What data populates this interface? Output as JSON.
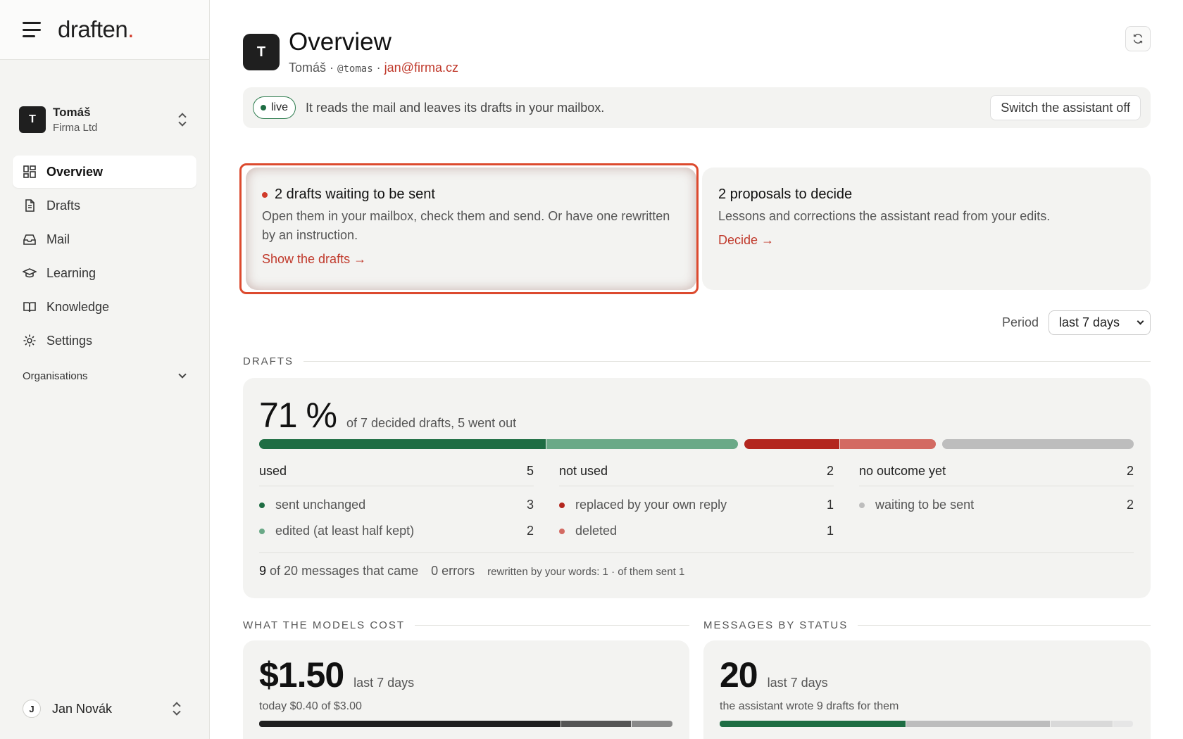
{
  "brand": {
    "name": "draften",
    "dot": "."
  },
  "account": {
    "initial": "T",
    "name": "Tomáš",
    "org": "Firma Ltd"
  },
  "nav": [
    {
      "label": "Overview",
      "icon": "dashboard-icon",
      "active": true
    },
    {
      "label": "Drafts",
      "icon": "document-icon"
    },
    {
      "label": "Mail",
      "icon": "inbox-icon"
    },
    {
      "label": "Learning",
      "icon": "graduation-cap-icon"
    },
    {
      "label": "Knowledge",
      "icon": "book-icon"
    },
    {
      "label": "Settings",
      "icon": "gear-icon"
    }
  ],
  "organisations_label": "Organisations",
  "user": {
    "initial": "J",
    "name": "Jan Novák"
  },
  "header": {
    "initial": "T",
    "title": "Overview",
    "name": "Tomáš",
    "handle": "@tomas",
    "email": "jan@firma.cz",
    "sep": "·"
  },
  "status": {
    "badge": "live",
    "text": "It reads the mail and leaves its drafts in your mailbox.",
    "button": "Switch the assistant off"
  },
  "cards": {
    "drafts_waiting": {
      "title": "2 drafts waiting to be sent",
      "desc": "Open them in your mailbox, check them and send. Or have one rewritten by an instruction.",
      "link": "Show the drafts →"
    },
    "proposals": {
      "title": "2 proposals to decide",
      "desc": "Lessons and corrections the assistant read from your edits.",
      "link": "Decide →"
    }
  },
  "period": {
    "label": "Period",
    "value": "last 7 days"
  },
  "drafts": {
    "section": "DRAFTS",
    "percent": "71 %",
    "summary": "of 7 decided drafts, 5 went out",
    "bar": [
      {
        "name": "sent-unchanged",
        "value": 3,
        "color": "#1e6d43"
      },
      {
        "name": "edited",
        "value": 2,
        "color": "#6aa987"
      },
      {
        "name": "replaced",
        "value": 1,
        "color": "#b3261e"
      },
      {
        "name": "deleted",
        "value": 1,
        "color": "#d36a62"
      },
      {
        "name": "waiting",
        "value": 2,
        "color": "#bdbdbd"
      }
    ],
    "columns": [
      {
        "label": "used",
        "count": "5",
        "rows": [
          {
            "label": "sent unchanged",
            "count": "3",
            "color": "#1e6d43"
          },
          {
            "label": "edited (at least half kept)",
            "count": "2",
            "color": "#6aa987"
          }
        ]
      },
      {
        "label": "not used",
        "count": "2",
        "rows": [
          {
            "label": "replaced by your own reply",
            "count": "1",
            "color": "#b3261e"
          },
          {
            "label": "deleted",
            "count": "1",
            "color": "#d36a62"
          }
        ]
      },
      {
        "label": "no outcome yet",
        "count": "2",
        "rows": [
          {
            "label": "waiting to be sent",
            "count": "2",
            "color": "#bdbdbd"
          }
        ]
      }
    ],
    "footer": {
      "processed": "9",
      "processed_text": "of 20 messages that came",
      "errors": "0 errors",
      "rewritten": "rewritten by your words: 1 · of them sent 1"
    }
  },
  "cost": {
    "section": "WHAT THE MODELS COST",
    "value": "$1.50",
    "period": "last 7 days",
    "sub": "today $0.40 of $3.00",
    "bar": [
      {
        "value": 0.73,
        "color": "#1f1f1f"
      },
      {
        "value": 0.17,
        "color": "#555555"
      },
      {
        "value": 0.1,
        "color": "#8a8a8a"
      }
    ]
  },
  "messages": {
    "section": "MESSAGES BY STATUS",
    "value": "20",
    "period": "last 7 days",
    "sub": "the assistant wrote 9 drafts for them",
    "bar": [
      {
        "value": 0.45,
        "color": "#1e6d43"
      },
      {
        "value": 0.35,
        "color": "#bdbdbd"
      },
      {
        "value": 0.15,
        "color": "#d9d9d9"
      },
      {
        "value": 0.05,
        "color": "#e6e6e6"
      }
    ]
  }
}
